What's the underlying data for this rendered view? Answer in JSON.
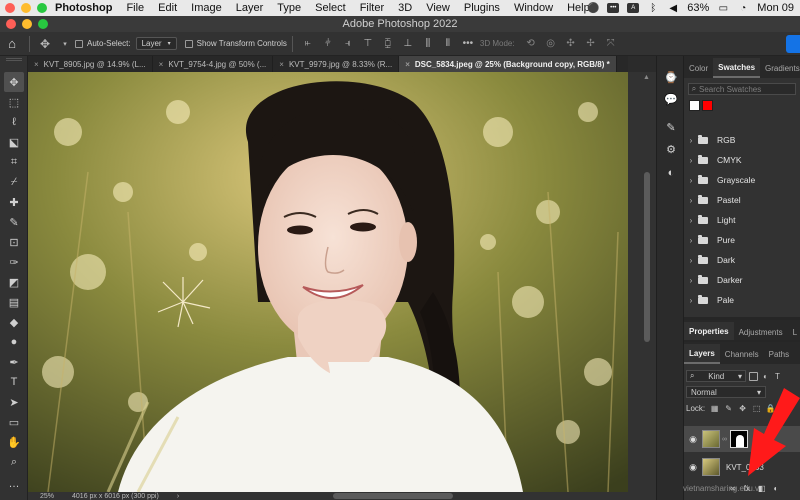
{
  "menubar": {
    "app_name": "Photoshop",
    "menus": [
      "File",
      "Edit",
      "Image",
      "Layer",
      "Type",
      "Select",
      "Filter",
      "3D",
      "View",
      "Plugins",
      "Window",
      "Help"
    ],
    "battery": "63%",
    "clock": "Mon 09",
    "status_icons": [
      "creative-cloud-icon",
      "lastpass-icon",
      "keyboard-icon",
      "bluetooth-icon",
      "volume-icon",
      "battery-icon",
      "wifi-icon"
    ]
  },
  "window": {
    "title": "Adobe Photoshop 2022"
  },
  "options": {
    "auto_select_label": "Auto-Select:",
    "auto_select_value": "Layer",
    "transform_label": "Show Transform Controls",
    "mode_3d_label": "3D Mode:"
  },
  "tabs": [
    {
      "label": "KVT_8905.jpg @ 14.9% (L...",
      "active": false
    },
    {
      "label": "KVT_9754-4.jpg @ 50% (...",
      "active": false
    },
    {
      "label": "KVT_9979.jpg @ 8.33% (R...",
      "active": false
    },
    {
      "label": "DSC_5834.jpeg @ 25% (Background copy, RGB/8) *",
      "active": true
    }
  ],
  "status": {
    "zoom": "25%",
    "doc_info": "4016 px x 6016 px (300 ppi)"
  },
  "swatches_panel": {
    "tabs": [
      "Color",
      "Swatches",
      "Gradients"
    ],
    "active_tab": "Swatches",
    "search_placeholder": "Search Swatches",
    "recent_colors": [
      "#ffffff",
      "#ff0000"
    ],
    "groups": [
      "RGB",
      "CMYK",
      "Grayscale",
      "Pastel",
      "Light",
      "Pure",
      "Dark",
      "Darker",
      "Pale"
    ]
  },
  "properties_panel": {
    "tabs": [
      "Properties",
      "Adjustments",
      "L"
    ]
  },
  "layers_panel": {
    "tabs": [
      "Layers",
      "Channels",
      "Paths"
    ],
    "kind_label": "Kind",
    "blend_mode": "Normal",
    "lock_label": "Lock:",
    "opacity_partial": "Fi",
    "layers": [
      {
        "name": "",
        "has_mask": true,
        "selected": true
      },
      {
        "name": "KVT_0463",
        "has_mask": false,
        "selected": false
      }
    ]
  },
  "watermark": "vietnamsharing.edu.vn",
  "colors": {
    "accent": "#1473e6",
    "annotation_arrow": "#ff1a1a",
    "traffic_red": "#fe5f57",
    "traffic_yellow": "#febc2e",
    "traffic_green": "#28c840"
  }
}
